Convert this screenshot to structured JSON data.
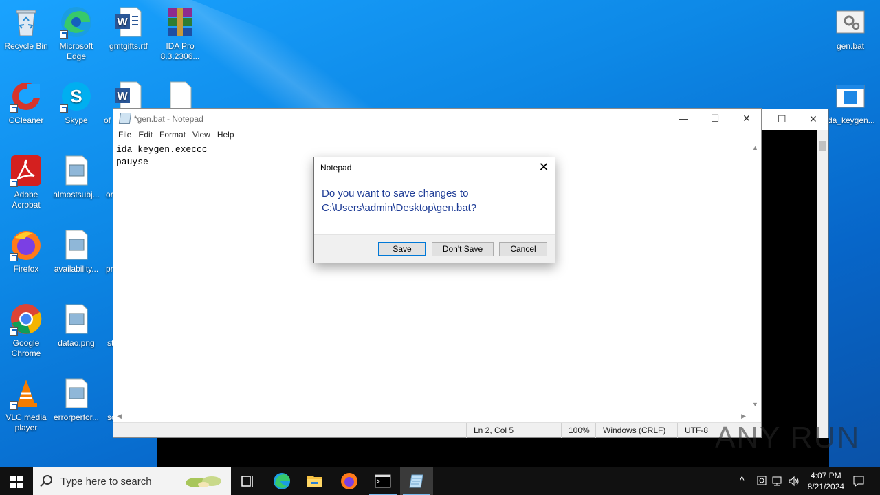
{
  "desktop": {
    "icons": [
      {
        "label": "Recycle Bin"
      },
      {
        "label": "Microsoft Edge"
      },
      {
        "label": "gmtgifts.rtf"
      },
      {
        "label": "IDA Pro 8.3.2306..."
      },
      {
        "label": "gen.bat"
      },
      {
        "label": "CCleaner"
      },
      {
        "label": "Skype"
      },
      {
        "label": "of"
      },
      {
        "label": "ida_keygen..."
      },
      {
        "label": "Adobe Acrobat"
      },
      {
        "label": "almostsubj..."
      },
      {
        "label": "or"
      },
      {
        "label": "Firefox"
      },
      {
        "label": "availability..."
      },
      {
        "label": "pr"
      },
      {
        "label": "Google Chrome"
      },
      {
        "label": "datao.png"
      },
      {
        "label": "st"
      },
      {
        "label": "VLC media player"
      },
      {
        "label": "errorperfor..."
      },
      {
        "label": "sc"
      }
    ]
  },
  "notepad": {
    "title": "*gen.bat - Notepad",
    "menu": [
      "File",
      "Edit",
      "Format",
      "View",
      "Help"
    ],
    "content": "ida_keygen.execcc\npauyse",
    "status": {
      "position": "Ln 2, Col 5",
      "zoom": "100%",
      "line_endings": "Windows (CRLF)",
      "encoding": "UTF-8"
    }
  },
  "dialog": {
    "title": "Notepad",
    "message_line1": "Do you want to save changes to",
    "message_line2": "C:\\Users\\admin\\Desktop\\gen.bat?",
    "buttons": {
      "save": "Save",
      "dont_save": "Don't Save",
      "cancel": "Cancel"
    }
  },
  "taskbar": {
    "search_placeholder": "Type here to search",
    "time": "4:07 PM",
    "date": "8/21/2024",
    "apps": [
      "task-view-icon",
      "edge-icon",
      "file-explorer-icon",
      "firefox-icon",
      "cmd-icon",
      "notepad-icon"
    ]
  },
  "watermark": "ANY RUN",
  "colors": {
    "accent": "#0078d7",
    "dialog_text": "#1e3c96",
    "taskbar": "#111111"
  }
}
